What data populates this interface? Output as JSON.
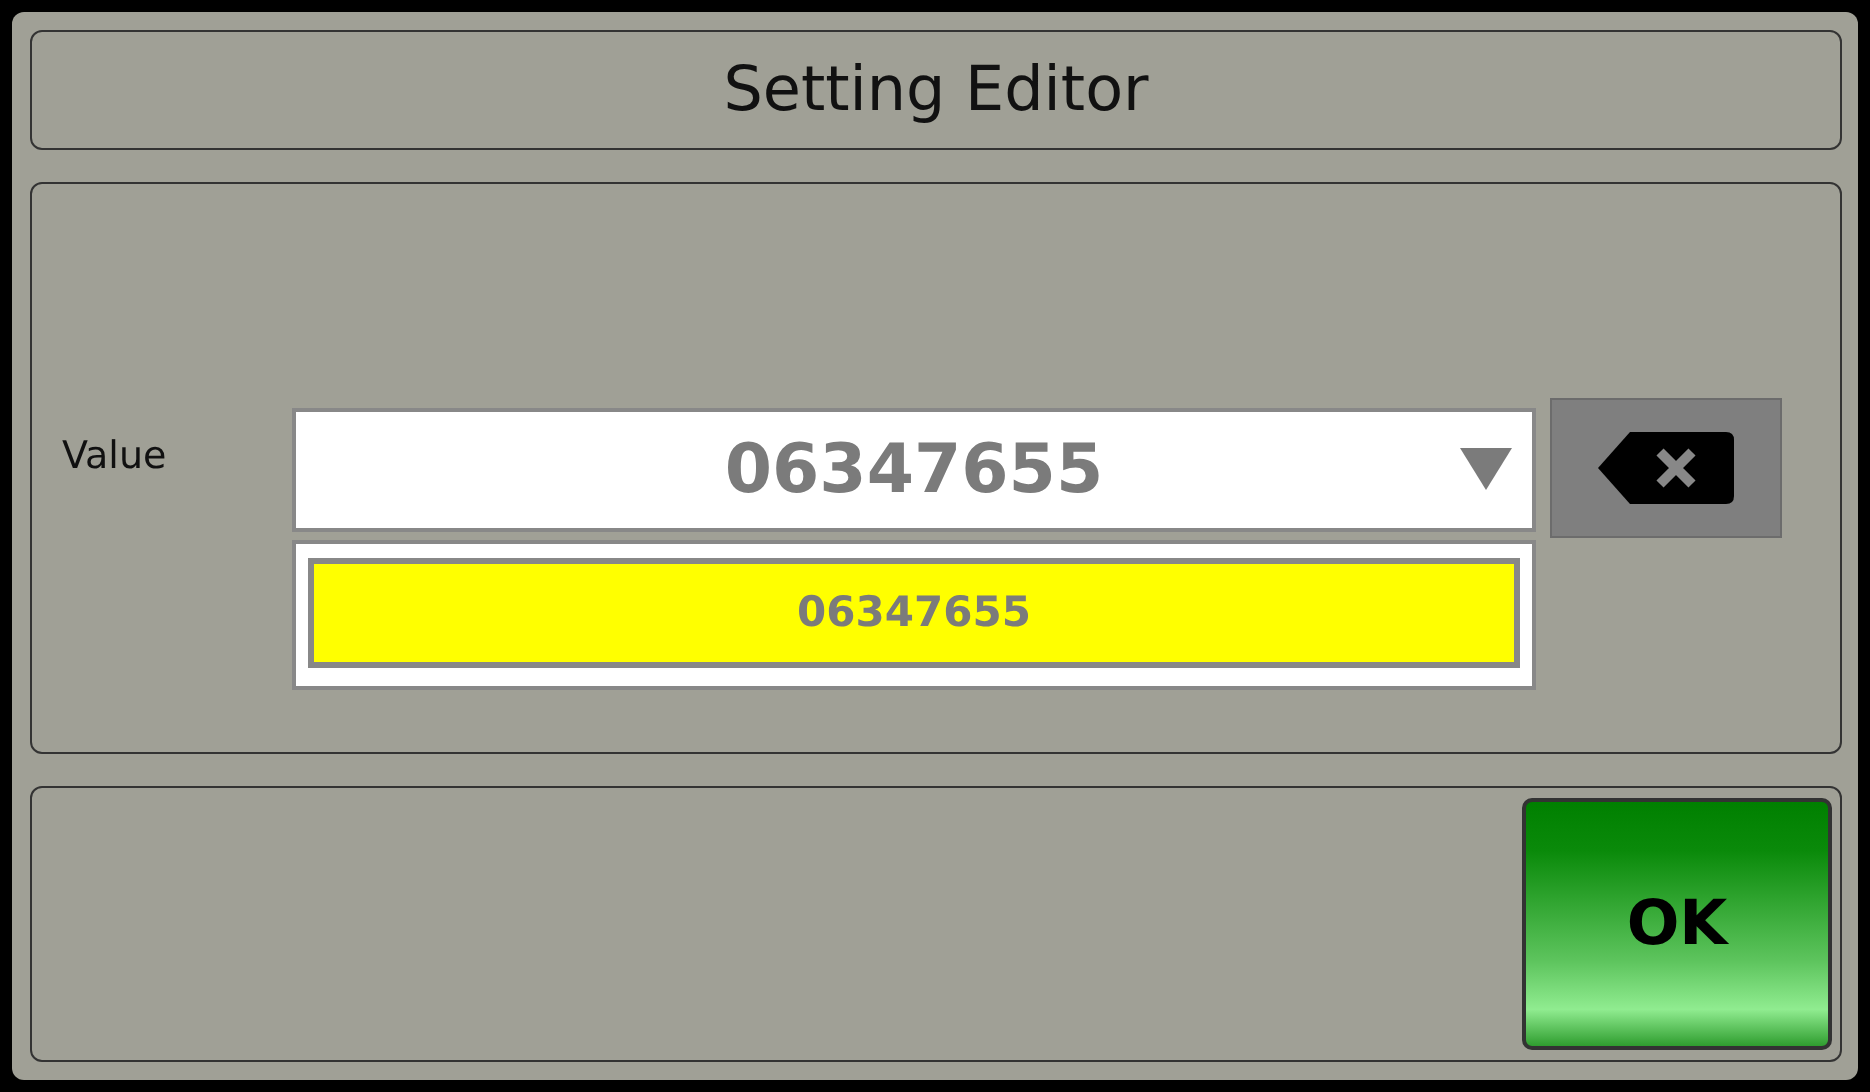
{
  "window": {
    "title": "Setting Editor"
  },
  "field": {
    "label": "Value",
    "value": "06347655",
    "expanded": true,
    "options": [
      {
        "text": "06347655",
        "selected": true
      }
    ]
  },
  "buttons": [
    {
      "kind": "ok",
      "label": "OK"
    }
  ]
}
